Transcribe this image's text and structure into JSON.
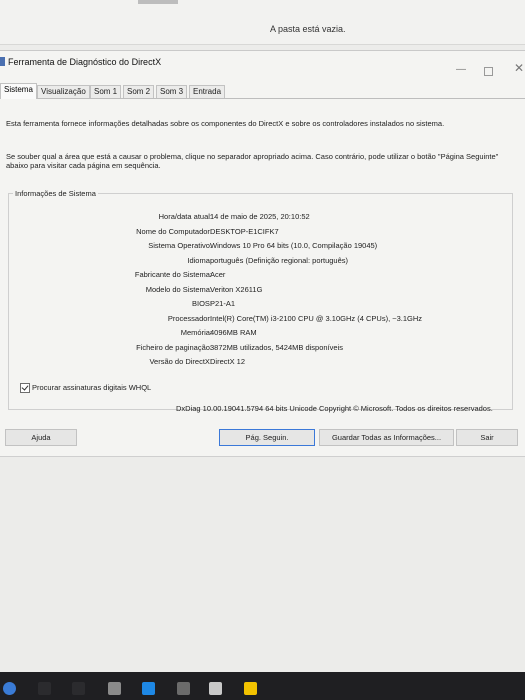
{
  "explorer": {
    "empty_message": "A pasta está vazia."
  },
  "window": {
    "title": "Ferramenta de Diagnóstico do DirectX",
    "controls": {
      "minimize": "—",
      "close": "✕"
    }
  },
  "tabs": [
    {
      "label": "Sistema",
      "active": true
    },
    {
      "label": "Visualização"
    },
    {
      "label": "Som 1"
    },
    {
      "label": "Som 2"
    },
    {
      "label": "Som 3"
    },
    {
      "label": "Entrada"
    }
  ],
  "description": {
    "line1": "Esta ferramenta fornece informações detalhadas sobre os componentes do DirectX e sobre os controladores instalados no sistema.",
    "line2": "Se souber qual a área que está a causar o problema, clique no separador apropriado acima. Caso contrário, pode utilizar o botão \"Página Seguinte\" abaixo para visitar cada página em sequência."
  },
  "system_info": {
    "group_title": "Informações de Sistema",
    "rows": [
      {
        "label": "Hora/data atual:",
        "value": "14 de maio de 2025, 20:10:52"
      },
      {
        "label": "Nome do Computador:",
        "value": "DESKTOP-E1CIFK7"
      },
      {
        "label": "Sistema Operativo:",
        "value": "Windows 10 Pro 64 bits (10.0, Compilação 19045)"
      },
      {
        "label": "Idioma:",
        "value": "português (Definição regional: português)"
      },
      {
        "label": "Fabricante do Sistema:",
        "value": "Acer"
      },
      {
        "label": "Modelo do Sistema:",
        "value": "Veriton X2611G"
      },
      {
        "label": "BIOS:",
        "value": "P21-A1"
      },
      {
        "label": "Processador:",
        "value": "Intel(R) Core(TM) i3-2100 CPU @ 3.10GHz (4 CPUs), ~3.1GHz"
      },
      {
        "label": "Memória:",
        "value": "4096MB RAM"
      },
      {
        "label": "Ficheiro de paginação:",
        "value": "3872MB utilizados, 5424MB disponíveis"
      },
      {
        "label": "Versão do DirectX:",
        "value": "DirectX 12"
      }
    ]
  },
  "whql": {
    "label": "Procurar assinaturas digitais WHQL",
    "checked": true
  },
  "copyright": "DxDiag 10.00.19041.5794 64 bits Unicode Copyright © Microsoft. Todos os direitos reservados.",
  "buttons": {
    "help": "Ajuda",
    "next_page": "Pág. Seguin.",
    "save_all": "Guardar Todas as Informações...",
    "exit": "Sair"
  },
  "taskbar": {
    "icon_colors": [
      "#3a7bd5",
      "#2b2b2e",
      "#2b2b2e",
      "#8a8a8a",
      "#1e88e5",
      "#6b6b6b",
      "#c9c9c9",
      "#f2c200"
    ]
  }
}
